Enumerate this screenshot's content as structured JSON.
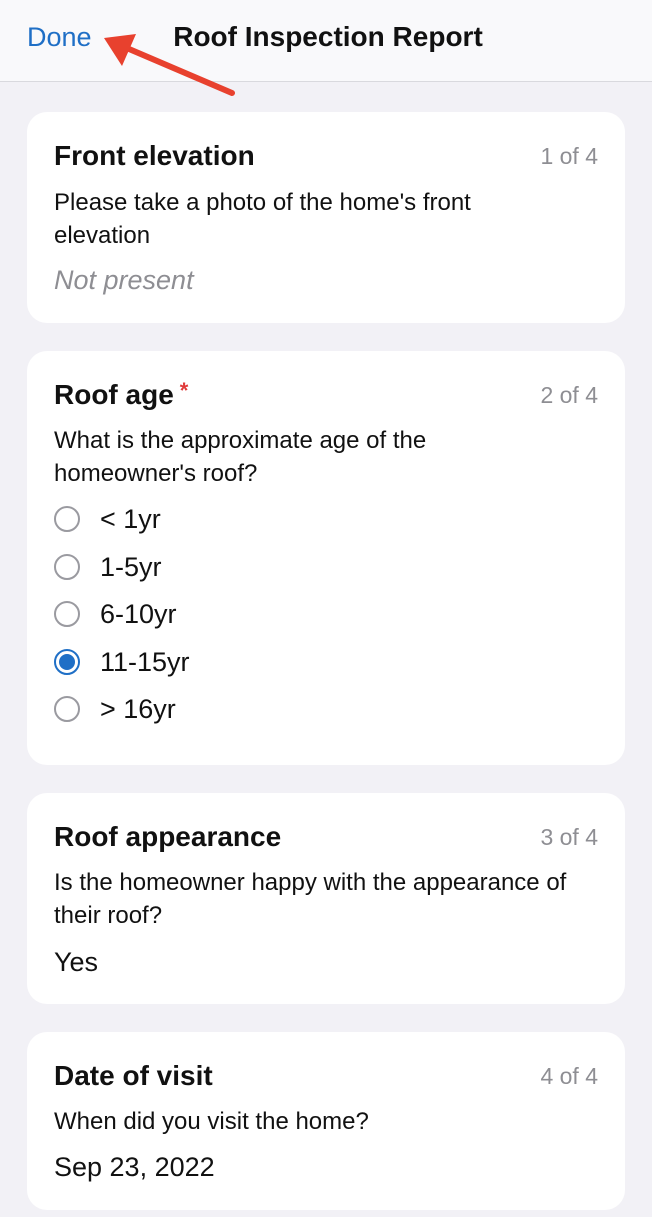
{
  "nav": {
    "done_label": "Done",
    "title": "Roof Inspection Report"
  },
  "colors": {
    "accent": "#1f6fc6",
    "required": "#e03a3a",
    "annotation_arrow": "#e8412e",
    "background": "#f2f1f6"
  },
  "icons": {
    "annotation": "red-arrow-icon",
    "radio": "radio-button-icon"
  },
  "cards": [
    {
      "title": "Front elevation",
      "counter": "1 of 4",
      "question": "Please take a photo of the home's front elevation",
      "answer": "Not present"
    },
    {
      "title": "Roof age",
      "required_mark": "*",
      "counter": "2 of 4",
      "question": "What is the approximate age of the homeowner's roof?",
      "options": [
        {
          "label": "< 1yr",
          "selected": false
        },
        {
          "label": "1-5yr",
          "selected": false
        },
        {
          "label": "6-10yr",
          "selected": false
        },
        {
          "label": "11-15yr",
          "selected": true
        },
        {
          "label": "> 16yr",
          "selected": false
        }
      ]
    },
    {
      "title": "Roof appearance",
      "counter": "3 of 4",
      "question": "Is the homeowner happy with the appearance of their roof?",
      "answer": "Yes"
    },
    {
      "title": "Date of visit",
      "counter": "4 of 4",
      "question": "When did you visit the home?",
      "answer": "Sep 23, 2022"
    }
  ]
}
